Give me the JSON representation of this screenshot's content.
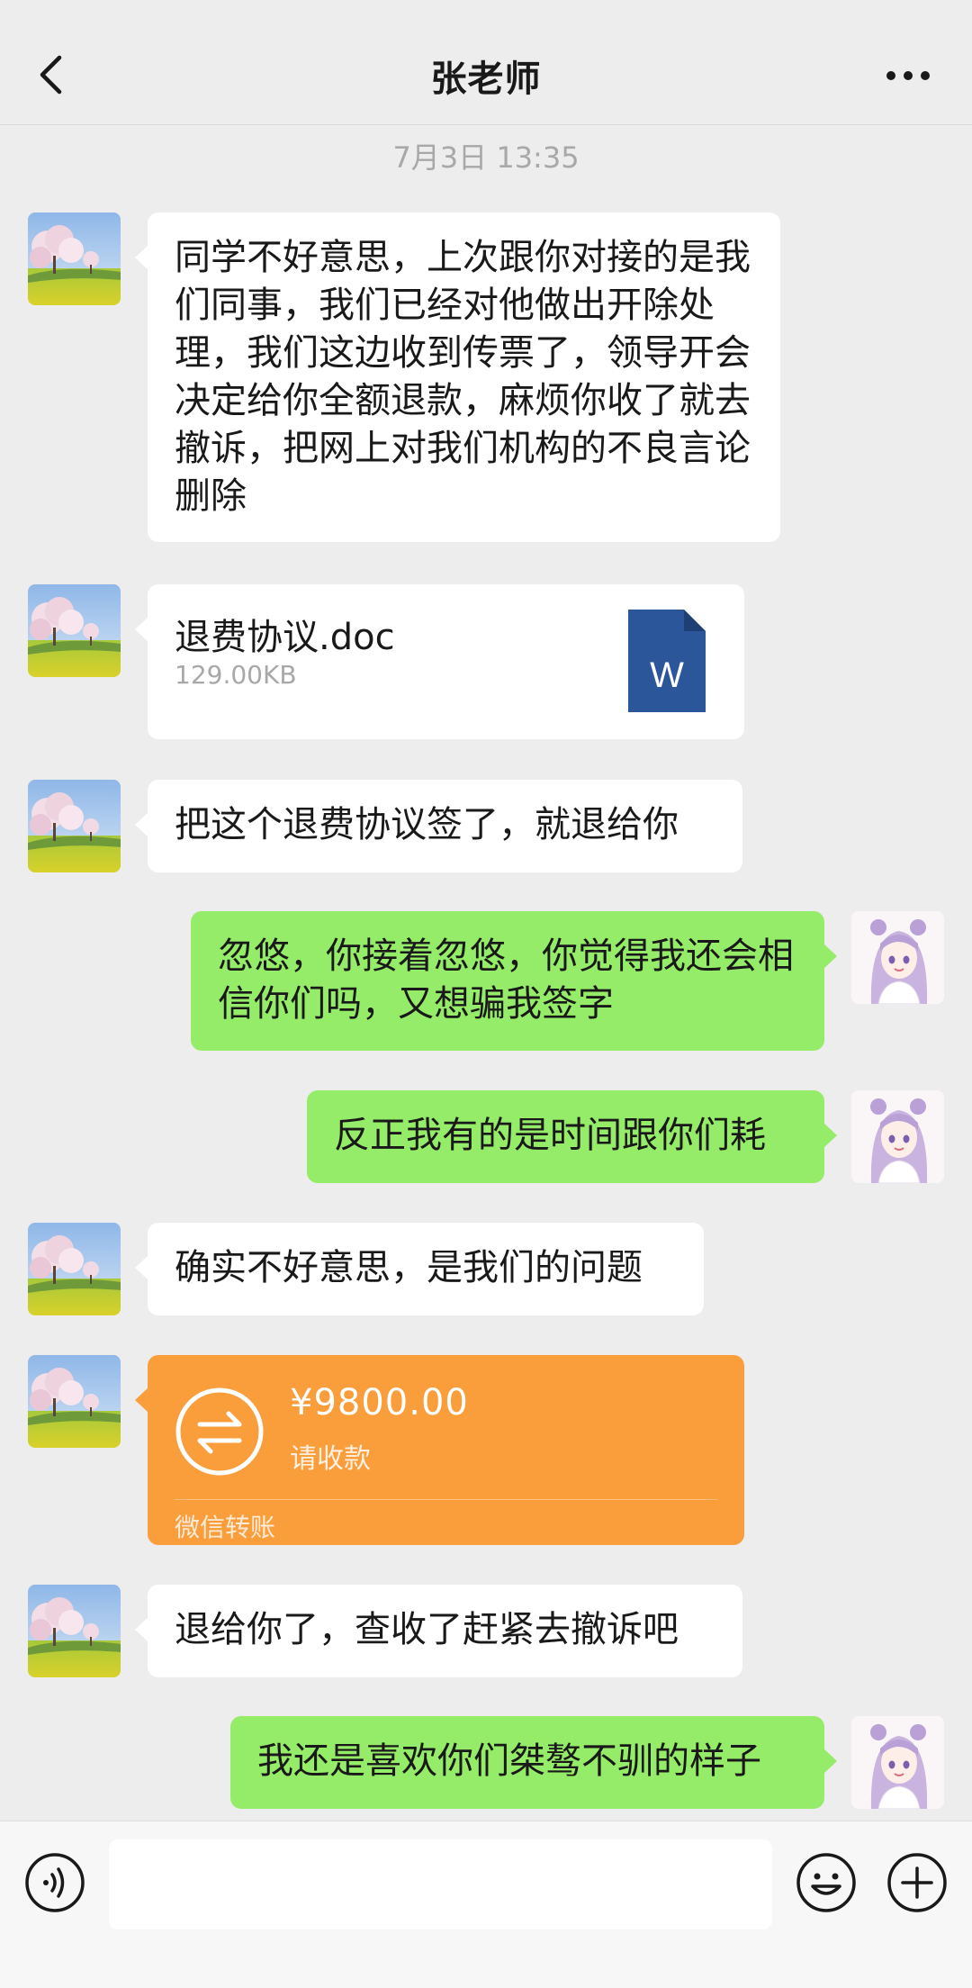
{
  "header": {
    "title": "张老师",
    "back_icon": "chevron-left-icon",
    "more_icon": "more-dots-icon"
  },
  "timestamp": "7月3日 13:35",
  "messages": [
    {
      "side": "left",
      "type": "text",
      "text": "同学不好意思，上次跟你对接的是我们同事，我们已经对他做出开除处理，我们这边收到传票了，领导开会决定给你全额退款，麻烦你收了就去撤诉，把网上对我们机构的不良言论删除"
    },
    {
      "side": "left",
      "type": "file",
      "filename": "退费协议.doc",
      "filesize": "129.00KB",
      "icon": "word-doc-icon",
      "icon_letter": "W"
    },
    {
      "side": "left",
      "type": "text",
      "text": "把这个退费协议签了，就退给你"
    },
    {
      "side": "right",
      "type": "text",
      "text": "忽悠，你接着忽悠，你觉得我还会相信你们吗，又想骗我签字"
    },
    {
      "side": "right",
      "type": "text",
      "text": "反正我有的是时间跟你们耗"
    },
    {
      "side": "left",
      "type": "text",
      "text": "确实不好意思，是我们的问题"
    },
    {
      "side": "left",
      "type": "transfer",
      "amount": "¥9800.00",
      "subtitle": "请收款",
      "footer": "微信转账",
      "icon": "transfer-arrows-icon"
    },
    {
      "side": "left",
      "type": "text",
      "text": "退给你了，查收了赶紧去撤诉吧"
    },
    {
      "side": "right",
      "type": "text",
      "text": "我还是喜欢你们桀骜不驯的样子"
    }
  ],
  "input_bar": {
    "voice_icon": "voice-icon",
    "emoji_icon": "emoji-icon",
    "plus_icon": "plus-icon",
    "input_value": ""
  },
  "colors": {
    "background": "#ededed",
    "incoming_bubble": "#ffffff",
    "outgoing_bubble": "#95ec69",
    "transfer_card": "#fa9d3b",
    "word_icon": "#2b579a"
  }
}
